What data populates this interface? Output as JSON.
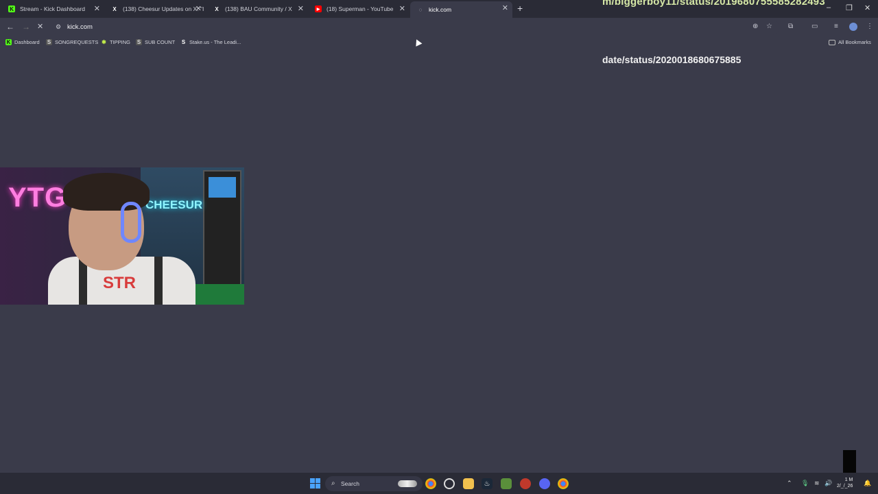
{
  "tabs": [
    {
      "label": "Stream - Kick Dashboard",
      "icon": "kick-icon",
      "color": "#53fc18"
    },
    {
      "label": "(138) Cheesur Updates on X: \"I",
      "icon": "x-icon",
      "color": "#ffffff"
    },
    {
      "label": "(138) BAU Community / X",
      "icon": "x-icon",
      "color": "#ffffff"
    },
    {
      "label": "(18) Superman - YouTube",
      "icon": "youtube-icon",
      "color": "#ff0000"
    },
    {
      "label": "kick.com",
      "icon": "loading-icon",
      "color": "#c9cad3"
    }
  ],
  "overlay_top_text": "m/biggerboy11/status/2019680755585282493",
  "overlay_page_text": "date/status/2020018680675885",
  "address_bar": {
    "url": "kick.com"
  },
  "bookmarks": [
    {
      "label": "Dashboard",
      "icon": "kick-icon"
    },
    {
      "label": "SONGREQUESTS",
      "icon": "songrequests-icon"
    },
    {
      "label": "TIPPING",
      "icon": "tipping-icon"
    },
    {
      "label": "SUB COUNT",
      "icon": "subcount-icon"
    },
    {
      "label": "Stake.us - The Leadi...",
      "icon": "stake-icon"
    }
  ],
  "all_bookmarks_label": "All Bookmarks",
  "webcam": {
    "neon_left": "YTG",
    "neon_right": "CHEESUR",
    "shirt_text": "STR"
  },
  "taskbar": {
    "search_label": "Search",
    "clock_time": "1 M",
    "clock_date": "2/_/_26"
  },
  "colors": {
    "background": "#3a3b4a",
    "tabbar": "#2a2b36",
    "kick_green": "#53fc18"
  }
}
